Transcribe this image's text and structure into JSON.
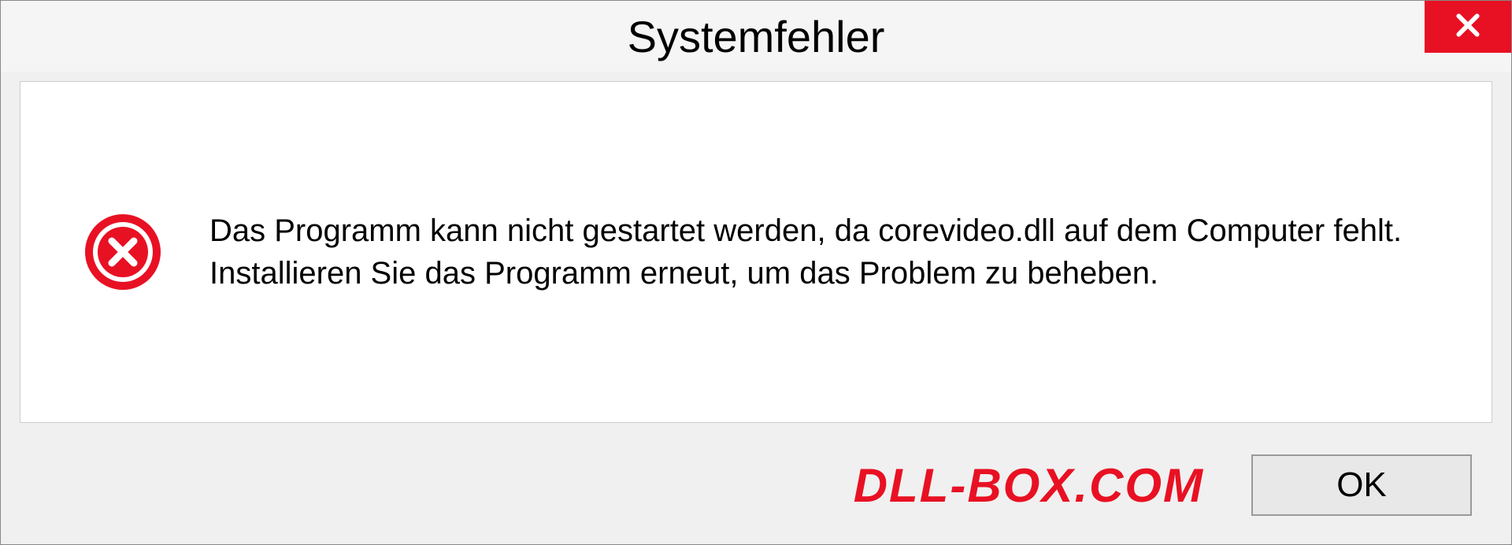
{
  "dialog": {
    "title": "Systemfehler",
    "message": "Das Programm kann nicht gestartet werden, da corevideo.dll auf dem Computer fehlt. Installieren Sie das Programm erneut, um das Problem zu beheben.",
    "ok_label": "OK"
  },
  "watermark": "DLL-BOX.COM",
  "colors": {
    "error_red": "#e81123",
    "close_red": "#e81123"
  }
}
